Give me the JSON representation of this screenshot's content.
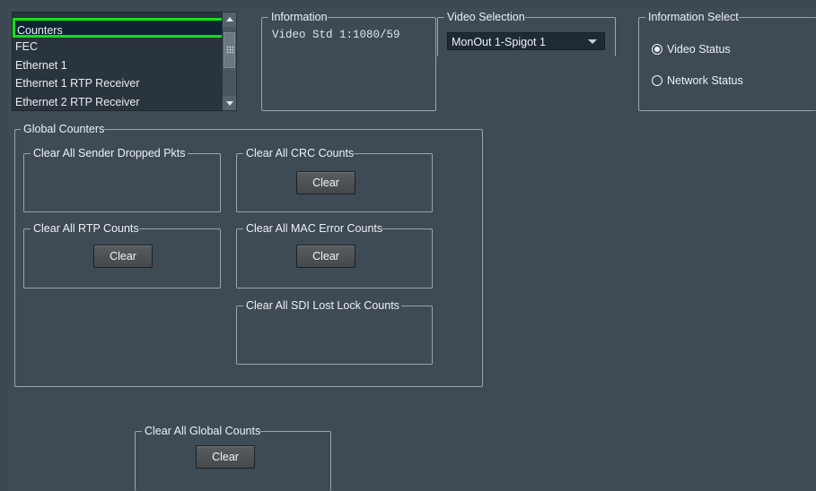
{
  "list": {
    "items": [
      "Counters",
      "FEC",
      "Ethernet 1",
      "Ethernet 1 RTP Receiver",
      "Ethernet 2 RTP Receiver"
    ],
    "selected": "Counters"
  },
  "information": {
    "title": "Information",
    "text": "Video Std 1:1080/59"
  },
  "video_selection": {
    "title": "Video Selection",
    "value": "MonOut 1-Spigot 1"
  },
  "information_select": {
    "title": "Information Select",
    "options": [
      {
        "label": "Video Status",
        "selected": true
      },
      {
        "label": "Network Status",
        "selected": false
      }
    ]
  },
  "global_counters": {
    "title": "Global Counters",
    "groups": {
      "sender_dropped": {
        "title": "Clear All Sender Dropped Pkts"
      },
      "crc": {
        "title": "Clear All CRC Counts",
        "button": "Clear"
      },
      "rtp": {
        "title": "Clear All RTP Counts",
        "button": "Clear"
      },
      "mac": {
        "title": "Clear All MAC Error Counts",
        "button": "Clear"
      },
      "sdi": {
        "title": "Clear All SDI Lost Lock Counts"
      }
    }
  },
  "clear_all_global": {
    "title": "Clear All Global Counts",
    "button": "Clear"
  },
  "colors": {
    "background": "#3e4a54",
    "selection_outline": "#10e016",
    "list_background": "#2a343d"
  }
}
